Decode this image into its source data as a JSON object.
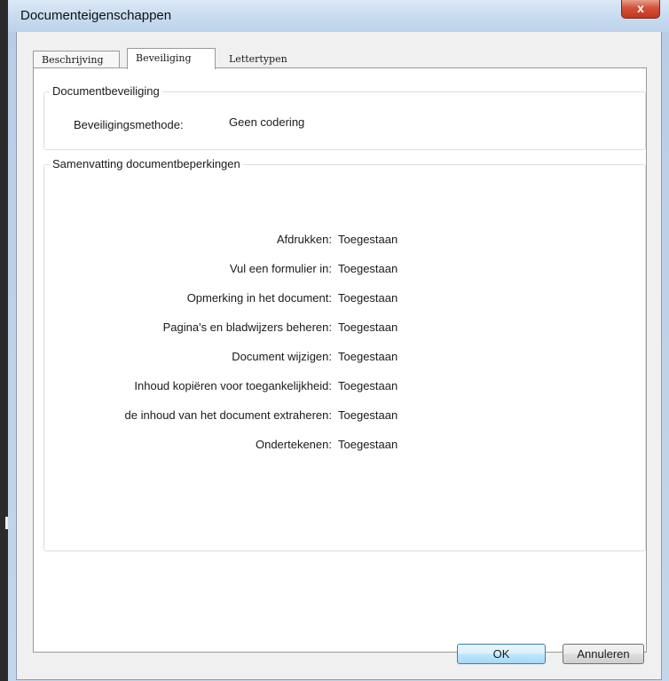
{
  "window": {
    "title": "Documenteigenschappen",
    "close_glyph": "x"
  },
  "tabs": [
    {
      "label": "Beschrijving",
      "active": false
    },
    {
      "label": "Beveiliging",
      "active": true
    },
    {
      "label": "Lettertypen",
      "active": false
    }
  ],
  "security": {
    "group_title": "Documentbeveiliging",
    "method_label": "Beveiligingsmethode:",
    "method_value": "Geen codering"
  },
  "restrictions": {
    "group_title": "Samenvatting documentbeperkingen",
    "items": [
      {
        "label": "Afdrukken:",
        "value": "Toegestaan"
      },
      {
        "label": "Vul een formulier in:",
        "value": "Toegestaan"
      },
      {
        "label": "Opmerking in het document:",
        "value": "Toegestaan"
      },
      {
        "label": "Pagina's en bladwijzers beheren:",
        "value": "Toegestaan"
      },
      {
        "label": "Document wijzigen:",
        "value": "Toegestaan"
      },
      {
        "label": "Inhoud kopiëren voor toegankelijkheid:",
        "value": "Toegestaan"
      },
      {
        "label": "de inhoud van het document extraheren:",
        "value": "Toegestaan"
      },
      {
        "label": "Ondertekenen:",
        "value": "Toegestaan"
      }
    ]
  },
  "buttons": {
    "ok": "OK",
    "cancel": "Annuleren"
  }
}
